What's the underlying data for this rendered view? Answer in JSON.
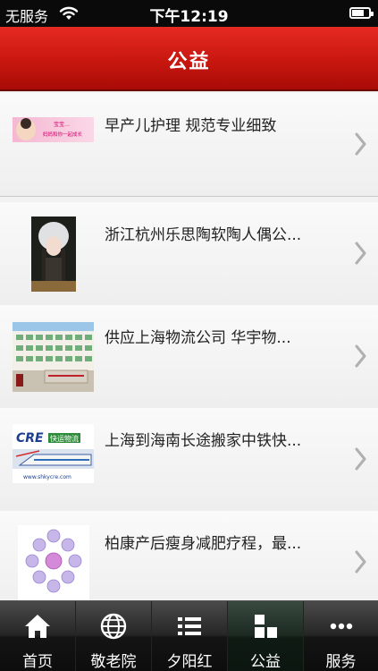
{
  "status_bar": {
    "carrier": "无服务",
    "time": "下午12:19",
    "battery_level": 0.7
  },
  "header": {
    "title": "公益"
  },
  "list": {
    "items": [
      {
        "title": "早产儿护理 规范专业细致",
        "thumb_icon": "baby-care-banner",
        "thumb_text_1": "宝宝…",
        "thumb_text_2": "妈妈和你一起成长"
      },
      {
        "title": "浙江杭州乐思陶软陶人偶公...",
        "thumb_icon": "clay-doll-photo"
      },
      {
        "title": "供应上海物流公司 华宇物...",
        "thumb_icon": "logistics-building-photo"
      },
      {
        "title": "上海到海南长途搬家中铁快...",
        "thumb_icon": "crecc-express-logo",
        "thumb_text_1": "CRE",
        "thumb_text_2": "快运物流",
        "thumb_text_3": "www.shkycre.com"
      },
      {
        "title": "柏康产后瘦身减肥疗程，最...",
        "thumb_icon": "bubbles-graphic"
      }
    ]
  },
  "tab_bar": {
    "tabs": [
      {
        "label": "首页",
        "icon": "home-icon",
        "active": false
      },
      {
        "label": "敬老院",
        "icon": "globe-icon",
        "active": false
      },
      {
        "label": "夕阳红",
        "icon": "list-icon",
        "active": false
      },
      {
        "label": "公益",
        "icon": "grid-icon",
        "active": true
      },
      {
        "label": "服务",
        "icon": "more-icon",
        "active": false
      }
    ]
  },
  "colors": {
    "header_red": "#c8170f",
    "tab_bar_dark": "#141414",
    "active_tab_green": "#0e1b13",
    "chevron_gray": "#b0b0b0"
  }
}
